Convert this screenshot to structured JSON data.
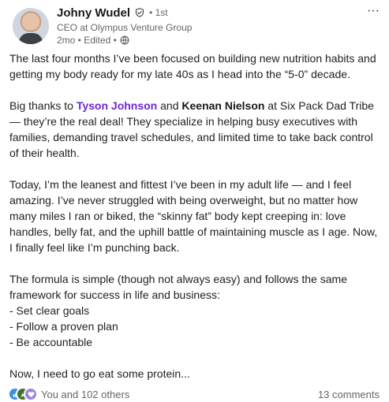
{
  "header": {
    "name": "Johny Wudel",
    "degree": "• 1st",
    "headline": "CEO at Olympus Venture Group",
    "time": "2mo • Edited •",
    "more": "···"
  },
  "body": {
    "p1": "The last four months I’ve been focused on building new nutrition habits and getting my body ready for my late 40s as I head into the “5-0” decade.",
    "p2": {
      "pre": "Big thanks to ",
      "mention1": "Tyson Johnson",
      "mid": " and ",
      "mention2": "Keenan Nielson",
      "post": " at Six Pack Dad Tribe — they’re the real deal! They specialize in helping busy executives with families, demanding travel schedules, and limited time to take back control of their health."
    },
    "p3": "Today, I’m the leanest and fittest I’ve been in my adult life — and I feel amazing. I’ve never struggled with being overweight, but no matter how many miles I ran or biked, the “skinny fat” body kept creeping in: love handles, belly fat, and the uphill battle of maintaining muscle as I age. Now, I finally feel like I’m punching back.",
    "p4_intro": "The formula is simple (though not always easy) and follows the same framework for success in life and business:",
    "list": [
      "- Set clear goals",
      "- Follow a proven plan",
      "- Be accountable"
    ],
    "p5": "Now, I need to go eat some protein..."
  },
  "footer": {
    "reactions_text": "You and 102 others",
    "comments_text": "13 comments"
  },
  "colors": {
    "mention": "#6d28d9",
    "like": "#378fe9",
    "celebrate": "#44712e",
    "support": "#9d86d8"
  },
  "icons": {
    "verified": "verified-shield-icon",
    "visibility": "globe-icon",
    "reactions": [
      "like-icon",
      "celebrate-icon",
      "support-icon"
    ]
  }
}
